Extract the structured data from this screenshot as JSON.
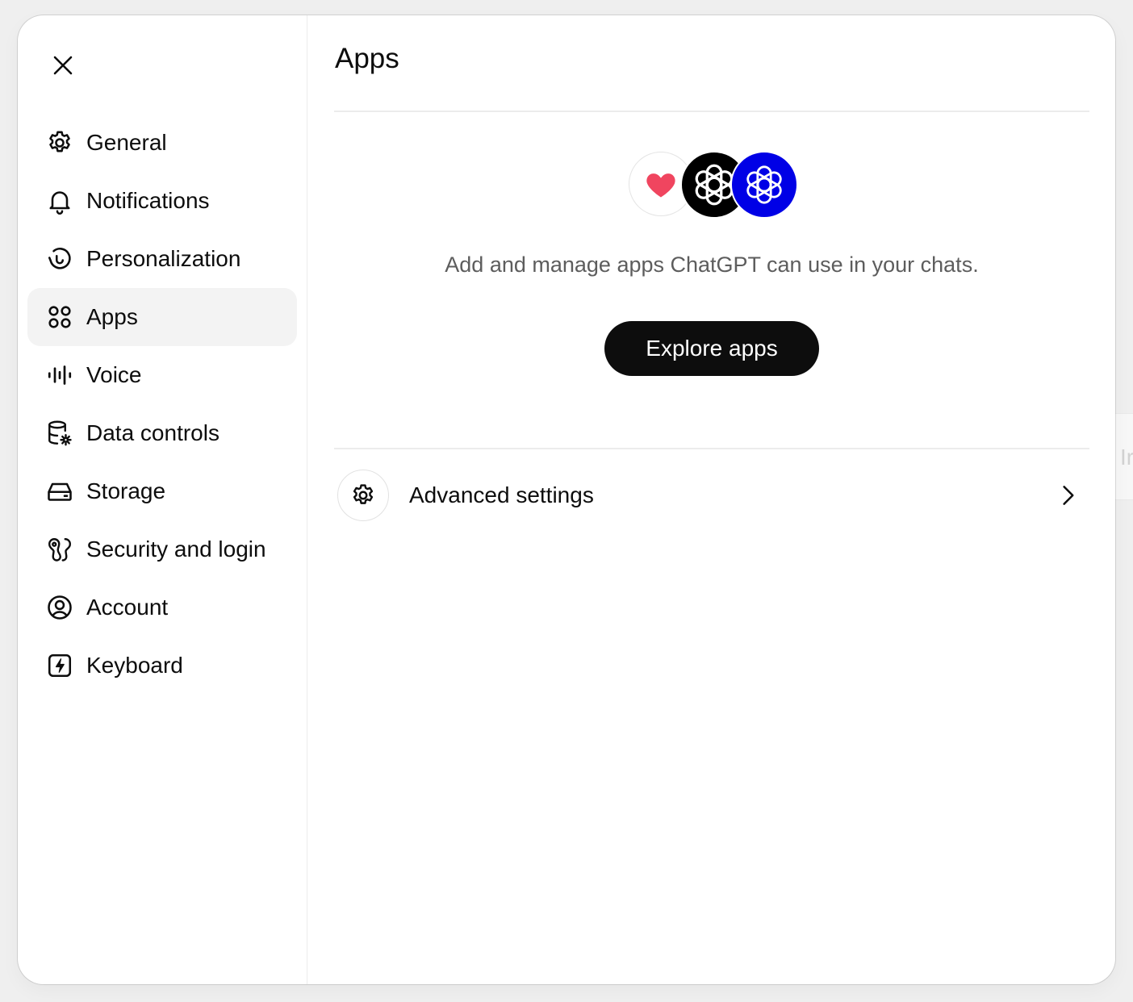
{
  "sidebar": {
    "close_label": "close",
    "items": [
      {
        "label": "General",
        "icon": "gear-icon",
        "active": false
      },
      {
        "label": "Notifications",
        "icon": "bell-icon",
        "active": false
      },
      {
        "label": "Personalization",
        "icon": "personalization-icon",
        "active": false
      },
      {
        "label": "Apps",
        "icon": "apps-grid-icon",
        "active": true
      },
      {
        "label": "Voice",
        "icon": "voice-waveform-icon",
        "active": false
      },
      {
        "label": "Data controls",
        "icon": "database-gear-icon",
        "active": false
      },
      {
        "label": "Storage",
        "icon": "storage-drive-icon",
        "active": false
      },
      {
        "label": "Security and login",
        "icon": "security-icon",
        "active": false
      },
      {
        "label": "Account",
        "icon": "account-circle-icon",
        "active": false
      },
      {
        "label": "Keyboard",
        "icon": "keyboard-lightning-icon",
        "active": false
      }
    ]
  },
  "main": {
    "title": "Apps",
    "description": "Add and manage apps ChatGPT can use in your chats.",
    "explore_button": "Explore apps",
    "app_logos": [
      "heart-icon",
      "openai-logo-icon",
      "openai-logo-icon"
    ],
    "advanced_settings": {
      "label": "Advanced settings",
      "icon": "gear-icon",
      "chevron": "chevron-right-icon"
    }
  },
  "backdrop": {
    "partial_text": "Ir"
  },
  "colors": {
    "active_bg": "#f3f3f3",
    "button_bg": "#0d0d0d",
    "blue_logo_bg": "#0000e6",
    "heart": "#f0455f",
    "muted_text": "#5d5d5d"
  }
}
